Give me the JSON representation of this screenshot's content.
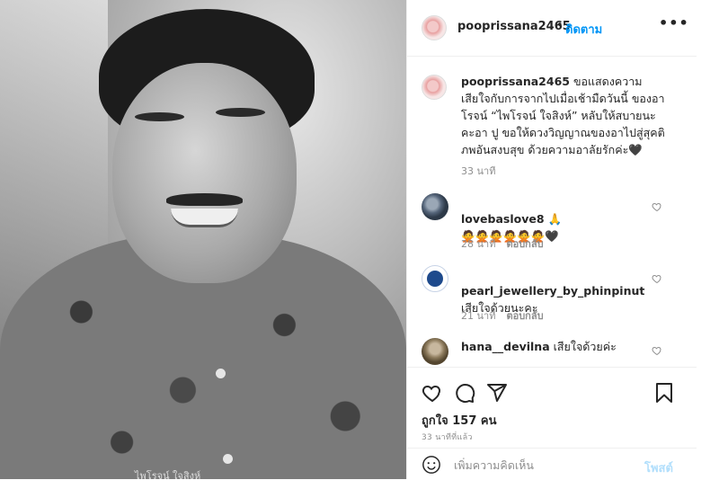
{
  "post": {
    "username": "pooprissana2465",
    "separator": "•",
    "follow_label": "ติดตาม",
    "more_label": "•••",
    "photo_caption": "ไพโรจน์ ใจสิงห์"
  },
  "caption": {
    "username": "pooprissana2465",
    "text": " ขอแสดงความเสียใจกับการจากไปเมื่อเช้ามืดวันนี้ ของอาโรจน์ “ไพโรจน์ ใจสิงห์” หลับให้สบายนะคะอา ปู ขอให้ดวงวิญญาณของอาไปสู่สุคติภพอันสงบสุข ด้วยความอาลัยรักค่ะ🖤",
    "time": "33 นาที"
  },
  "comments": [
    {
      "username": "lovebaslove8",
      "text": " 🙏\n🙅🙅🙅🙅🙅🙅🖤",
      "time": "28 นาที",
      "reply_label": "ตอบกลับ"
    },
    {
      "username": "pearl_jewellery_by_phinpinut",
      "text": "\nเสียใจด้วยนะคะ",
      "time": "21 นาที",
      "reply_label": "ตอบกลับ"
    },
    {
      "username": "hana__devilna",
      "text": " เสียใจด้วยค่ะ"
    }
  ],
  "actions": {
    "likes_text": "ถูกใจ 157 คน",
    "time_ago": "33 นาทีที่แล้ว"
  },
  "add_comment": {
    "placeholder": "เพิ่มความคิดเห็น",
    "post_label": "โพสต์"
  },
  "colors": {
    "link": "#0095f6",
    "text": "#262626",
    "muted": "#8e8e8e",
    "post_disabled": "#b2dffc"
  },
  "icons": [
    "heart-icon",
    "comment-icon",
    "share-icon",
    "bookmark-icon",
    "emoji-icon",
    "more-icon"
  ]
}
